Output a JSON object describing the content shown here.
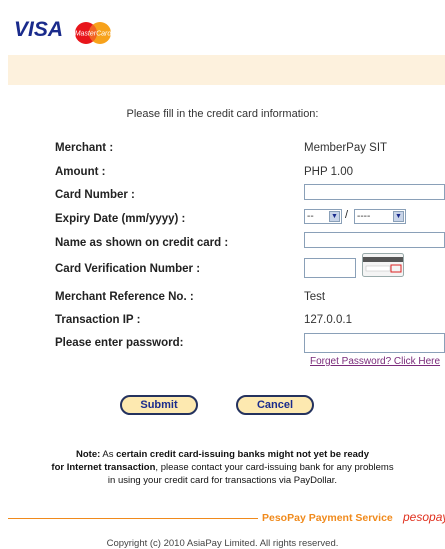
{
  "logos": {
    "visa": "VISA",
    "mastercard": "MasterCard"
  },
  "intro": "Please fill in the credit card information:",
  "fields": {
    "merchant": {
      "label": "Merchant :",
      "value": "MemberPay SIT"
    },
    "amount": {
      "label": "Amount :",
      "currency": "PHP",
      "value": "1.00"
    },
    "card_number": {
      "label": "Card Number :",
      "value": ""
    },
    "expiry": {
      "label": "Expiry Date (mm/yyyy) :",
      "month": "--",
      "separator": "/",
      "year": "----"
    },
    "name": {
      "label": "Name as shown on credit card :",
      "value": ""
    },
    "cvn": {
      "label": "Card Verification Number :",
      "value": ""
    },
    "reference": {
      "label": "Merchant Reference No. :",
      "value": "Test"
    },
    "ip": {
      "label": "Transaction IP :",
      "value": "127.0.0.1"
    },
    "password": {
      "label": "Please enter password:",
      "value": "",
      "forgot_link": "Forget Password? Click Here"
    }
  },
  "buttons": {
    "submit": "Submit",
    "cancel": "Cancel"
  },
  "note": {
    "line1_bold_a": "Note:",
    "line1_rest_a": " As ",
    "line1_bold_b": "certain credit card-issuing banks might not yet be ready",
    "line2_bold": "for Internet transaction",
    "line2_rest": ", please contact your card-issuing bank for any problems",
    "line3": "in using your credit card for transactions via PayDollar."
  },
  "footer": {
    "service": "PesoPay Payment Service",
    "brand": "pesopay",
    "copyright": "Copyright (c) 2010 AsiaPay Limited. All rights reserved."
  },
  "colors": {
    "accent": "#f08a1c",
    "band": "#fdf1dd",
    "button_fill": "#fde9b0",
    "visa_blue": "#1a2b8c"
  }
}
